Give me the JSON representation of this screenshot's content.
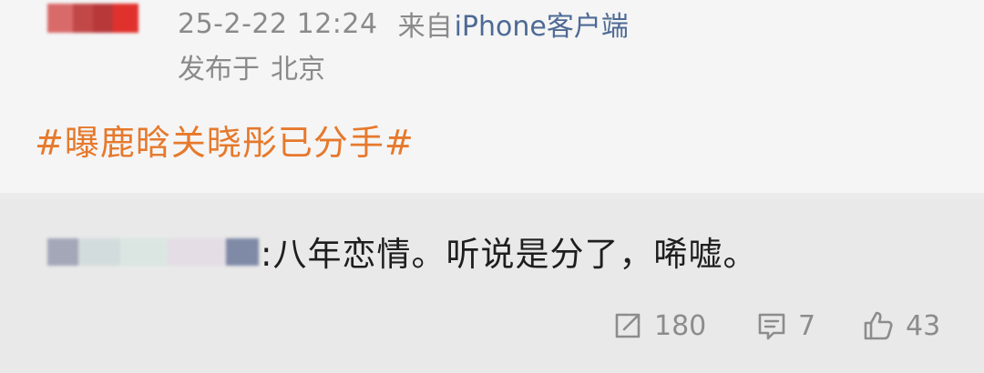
{
  "post": {
    "time": "25-2-22 12:24",
    "from_prefix": "来自",
    "client": "iPhone客户端",
    "location_prefix": "发布于",
    "location": "北京",
    "hashtag": "#曝鹿晗关晓彤已分手#"
  },
  "reply": {
    "text": ":八年恋情。听说是分了，唏嘘。"
  },
  "actions": {
    "repost_icon": "repost-icon",
    "repost_count": "180",
    "comment_icon": "comment-icon",
    "comment_count": "7",
    "like_icon": "thumbs-up-icon",
    "like_count": "43"
  },
  "colors": {
    "hashtag": "#e6792c",
    "client_link": "#4e6a95",
    "meta_text": "#8a8a8a"
  }
}
